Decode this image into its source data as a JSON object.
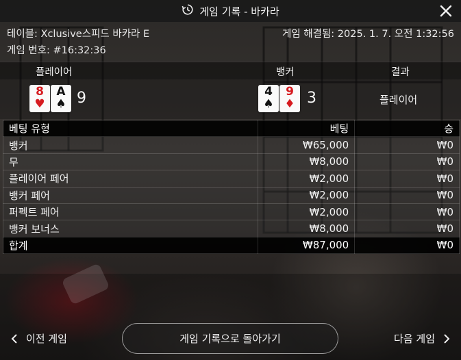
{
  "header": {
    "title": "게임 기록 - 바카라",
    "history_icon": "history-icon",
    "close_icon": "close-icon"
  },
  "info": {
    "table": "테이블: Xclusive스피드 바카라 E",
    "settled": "게임 해결됨: 2025. 1. 7. 오전 1:32:56",
    "game_number": "게임 번호: #16:32:36"
  },
  "hand": {
    "player_label": "플레이어",
    "banker_label": "뱅커",
    "result_label": "결과",
    "player_cards": [
      {
        "rank": "8",
        "suit": "♥",
        "color": "red"
      },
      {
        "rank": "A",
        "suit": "♠",
        "color": "black"
      }
    ],
    "player_score": "9",
    "banker_cards": [
      {
        "rank": "4",
        "suit": "♠",
        "color": "black"
      },
      {
        "rank": "9",
        "suit": "♦",
        "color": "red"
      }
    ],
    "banker_score": "3",
    "result": "플레이어"
  },
  "bets": {
    "headers": {
      "type": "베팅 유형",
      "bet": "베팅",
      "win": "승"
    },
    "rows": [
      {
        "type": "뱅커",
        "bet": "₩65,000",
        "win": "₩0"
      },
      {
        "type": "무",
        "bet": "₩8,000",
        "win": "₩0"
      },
      {
        "type": "플레이어 페어",
        "bet": "₩2,000",
        "win": "₩0"
      },
      {
        "type": "뱅커 페어",
        "bet": "₩2,000",
        "win": "₩0"
      },
      {
        "type": "퍼펙트 페어",
        "bet": "₩2,000",
        "win": "₩0"
      },
      {
        "type": "뱅커 보너스",
        "bet": "₩8,000",
        "win": "₩0"
      }
    ],
    "total": {
      "type": "합계",
      "bet": "₩87,000",
      "win": "₩0"
    }
  },
  "footer": {
    "prev": "이전 게임",
    "back": "게임 기록으로 돌아가기",
    "next": "다음 게임",
    "prev_icon": "chevron-left-icon",
    "next_icon": "chevron-right-icon"
  },
  "colors": {
    "red_suit": "#d61a1f",
    "black_suit": "#111111"
  }
}
